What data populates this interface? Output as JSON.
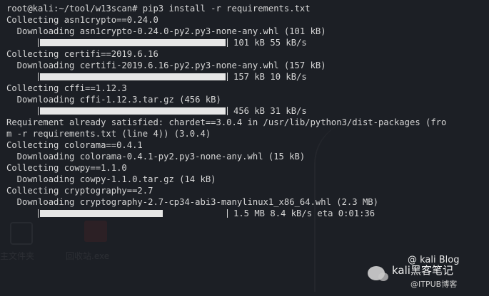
{
  "terminal": {
    "prompt": "root@kali:~/tool/w13scan#",
    "command": "pip3 install -r requirements.txt",
    "lines": [
      "Collecting asn1crypto==0.24.0",
      "  Downloading asn1crypto-0.24.0-py2.py3-none-any.whl (101 kB)",
      "Collecting certifi==2019.6.16",
      "  Downloading certifi-2019.6.16-py2.py3-none-any.whl (157 kB)",
      "Collecting cffi==1.12.3",
      "  Downloading cffi-1.12.3.tar.gz (456 kB)",
      "Requirement already satisfied: chardet==3.0.4 in /usr/lib/python3/dist-packages (fro",
      "m -r requirements.txt (line 4)) (3.0.4)",
      "Collecting colorama==0.4.1",
      "  Downloading colorama-0.4.1-py2.py3-none-any.whl (15 kB)",
      "Collecting cowpy==1.1.0",
      "  Downloading cowpy-1.1.0.tar.gz (14 kB)",
      "Collecting cryptography==2.7",
      "  Downloading cryptography-2.7-cp34-abi3-manylinux1_x86_64.whl (2.3 MB)"
    ],
    "progress": [
      {
        "fraction": 1.0,
        "status": "101 kB 55 kB/s"
      },
      {
        "fraction": 1.0,
        "status": "157 kB 10 kB/s"
      },
      {
        "fraction": 1.0,
        "status": "456 kB 31 kB/s"
      },
      {
        "fraction": 0.66,
        "status": "1.5 MB 8.4 kB/s eta 0:01:36"
      }
    ]
  },
  "background": {
    "caption_left": "主文件夹",
    "caption_right": "回收站.exe"
  },
  "watermark": {
    "name": "@ kali Blog",
    "title": "kali黑客笔记",
    "subtitle": "@ITPUB博客"
  },
  "colors": {
    "background": "#1c1f25",
    "text": "#d6d6d6",
    "bar": "#e6e6e6"
  }
}
